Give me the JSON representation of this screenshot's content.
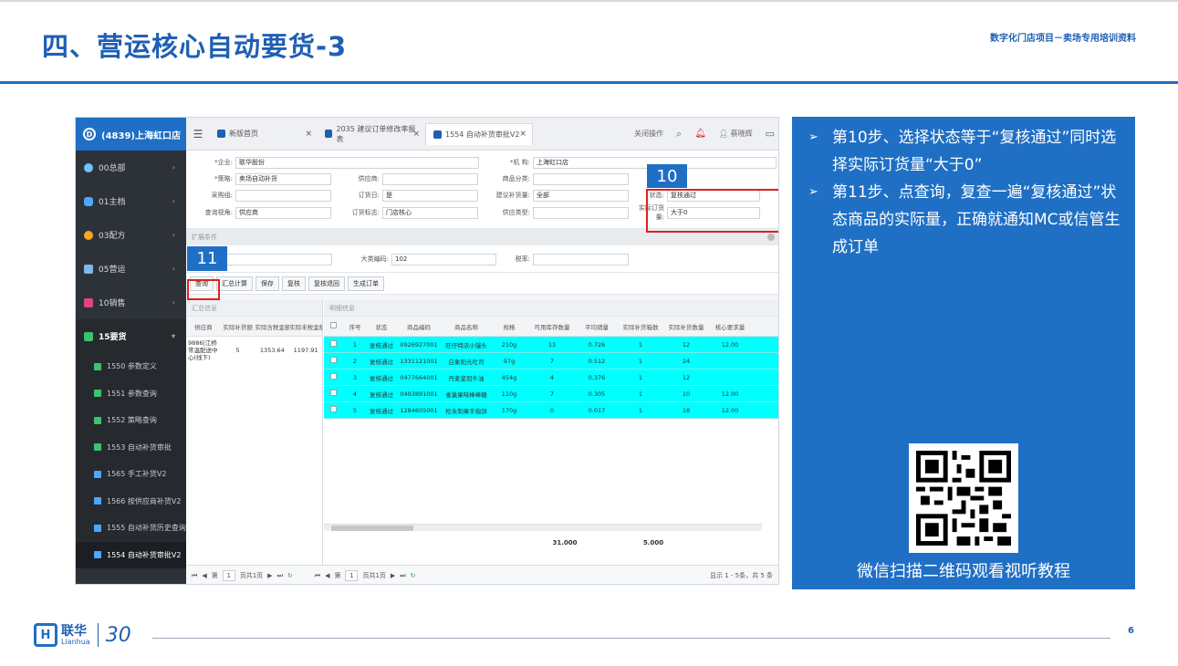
{
  "slide": {
    "title": "四、营运核心自动要货-3",
    "subtitle": "数字化门店项目－卖场专用培训资料",
    "page_number": "6"
  },
  "app": {
    "store_title": "(4839)上海虹口店",
    "logo_letter": "D",
    "nav": [
      {
        "label": "00总部"
      },
      {
        "label": "01主档"
      },
      {
        "label": "03配方"
      },
      {
        "label": "05营运"
      },
      {
        "label": "10销售"
      },
      {
        "label": "15要货"
      }
    ],
    "subnav": [
      {
        "label": "1550 参数定义"
      },
      {
        "label": "1551 参数查询"
      },
      {
        "label": "1552 策略查询"
      },
      {
        "label": "1553 自动补货审批"
      },
      {
        "label": "1565 手工补货V2"
      },
      {
        "label": "1566 按供应商补货V2"
      },
      {
        "label": "1555 自动补货历史查询"
      },
      {
        "label": "1554 自动补货审批V2"
      }
    ],
    "tabs": [
      {
        "label": "新版首页"
      },
      {
        "label": "2035 建议订单修改率报表"
      },
      {
        "label": "1554 自动补货审批V2"
      }
    ],
    "tab_close": "×",
    "toolbar_right": {
      "close_ops": "关闭操作",
      "user": "蔡晓辉"
    },
    "form": {
      "enterprise_label": "*企业:",
      "enterprise_value": "联华股份",
      "org_label": "*机 构:",
      "org_value": "上海虹口店",
      "strategy_label": "*策略:",
      "strategy_value": "卖场自动补货",
      "supplier_label": "供应商:",
      "supplier_value": "",
      "category_label": "商品分类:",
      "category_value": "",
      "buyer_label": "采购组:",
      "buyer_value": "",
      "orderday_label": "订货日:",
      "orderday_value": "是",
      "suggest_label": "建议补货量:",
      "suggest_value": "全部",
      "status_label": "状态:",
      "status_value": "复核通过",
      "view_label": "查询视角:",
      "view_value": "供应商",
      "ordertag_label": "订货标志:",
      "ordertag_value": "门店核心",
      "supptype_label": "供应类型:",
      "supptype_value": "",
      "actual_label": "实际订货量:",
      "actual_value": "大于0",
      "extend_label": "扩展条件",
      "bigcat_label": "大类编码:",
      "bigcat_value": "102",
      "tax_label": "税率:",
      "tax_value": ""
    },
    "buttons": [
      "查询",
      "汇总计算",
      "保存",
      "复核",
      "复核退回",
      "生成订单"
    ],
    "summary": {
      "title": "汇总信息",
      "headers": [
        "供应商",
        "实际补货额",
        "实际含税金额",
        "实际未税金额"
      ],
      "row": {
        "supplier": "9886|江桥常温配送中心(线下)",
        "count": "5",
        "tax_amount": "1353.64",
        "untaxed": "1197.91"
      }
    },
    "detail": {
      "title": "明细信息",
      "headers": [
        "序号",
        "状态",
        "商品编码",
        "商品名称",
        "规格",
        "可用库存数量",
        "平均销量",
        "实际补货箱数",
        "实际补货数量",
        "核心要求量"
      ],
      "rows": [
        {
          "no": "1",
          "status": "复核通过",
          "code": "0926927001",
          "name": "旺仔特浓小馒头",
          "spec": "210g",
          "stock": "13",
          "avg": "0.726",
          "boxes": "1",
          "qty": "12",
          "core": "12.00"
        },
        {
          "no": "2",
          "status": "复核通过",
          "code": "1331121001",
          "name": "白象阳光吐司",
          "spec": "97g",
          "stock": "7",
          "avg": "0.512",
          "boxes": "1",
          "qty": "24",
          "core": ""
        },
        {
          "no": "3",
          "status": "复核通过",
          "code": "0477664001",
          "name": "丹麦皇冠牛油",
          "spec": "454g",
          "stock": "4",
          "avg": "0.376",
          "boxes": "1",
          "qty": "12",
          "core": ""
        },
        {
          "no": "4",
          "status": "复核通过",
          "code": "0493891001",
          "name": "雀巢果味棒棒糖",
          "spec": "110g",
          "stock": "7",
          "avg": "0.305",
          "boxes": "1",
          "qty": "10",
          "core": "12.00"
        },
        {
          "no": "5",
          "status": "复核通过",
          "code": "1284605001",
          "name": "松永制果手指饼",
          "spec": "170g",
          "stock": "0",
          "avg": "0.017",
          "boxes": "1",
          "qty": "18",
          "core": "12.00"
        }
      ],
      "total_stock": "31.000",
      "total_boxes": "5.000"
    },
    "pager": {
      "page_label": "第",
      "page_value": "1",
      "of": "页共1页",
      "info": "显示 1 - 5条，共 5 条"
    }
  },
  "callouts": {
    "ten": "10",
    "eleven": "11"
  },
  "instructions": {
    "marker": "➢",
    "step10": "第10步、选择状态等于“复核通过”同时选择实际订货量“大于0”",
    "step11": "第11步、点查询，复查一遍“复核通过”状态商品的实际量，正确就通知MC或信管生成订单",
    "qr_caption": "微信扫描二维码观看视听教程"
  },
  "footer": {
    "brand_cn": "联华",
    "brand_en": "Lianhua",
    "anniv": "30",
    "logo_letter": "H"
  }
}
